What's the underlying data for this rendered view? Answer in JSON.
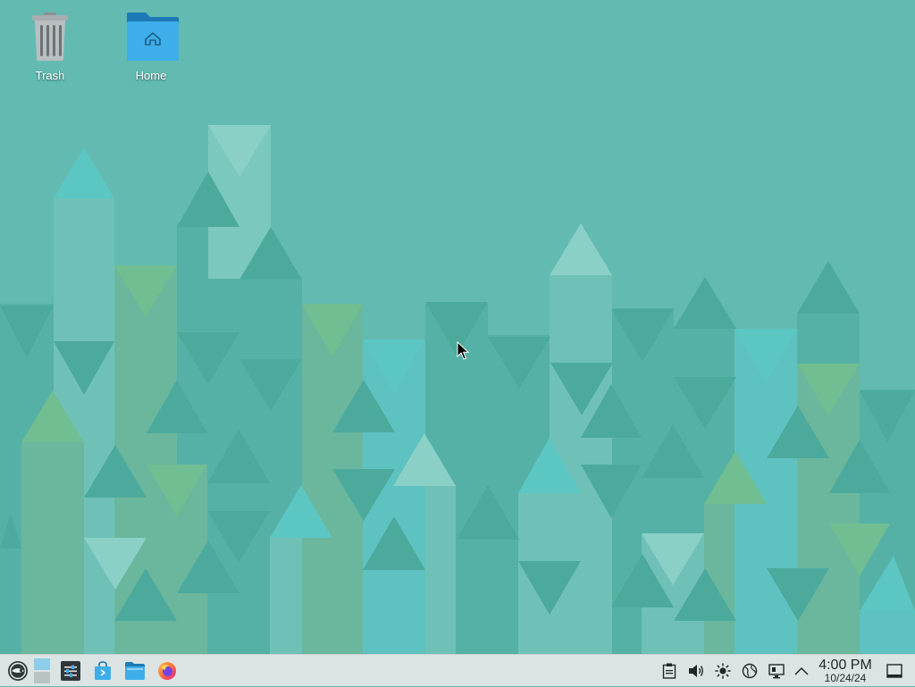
{
  "desktop": {
    "icons": [
      {
        "label": "Trash",
        "icon": "trash-icon"
      },
      {
        "label": "Home",
        "icon": "home-folder-icon"
      }
    ],
    "wallpaper_colors": {
      "base": "#63bab0",
      "dark": "#4fab9e",
      "light": "#8dd0c8",
      "cyan": "#5cc4c4",
      "green": "#72bb97"
    }
  },
  "taskbar": {
    "launchers": [
      {
        "name": "application-launcher",
        "icon": "opensuse-gecko-icon"
      },
      {
        "name": "virtual-desktop-pager",
        "icon": "pager-icon"
      },
      {
        "name": "system-settings",
        "icon": "settings-sliders-icon"
      },
      {
        "name": "discover",
        "icon": "shopping-bag-icon"
      },
      {
        "name": "dolphin-file-manager",
        "icon": "folder-icon"
      },
      {
        "name": "firefox",
        "icon": "firefox-icon"
      }
    ],
    "tray": [
      {
        "name": "clipboard",
        "icon": "clipboard-icon"
      },
      {
        "name": "volume",
        "icon": "speaker-icon"
      },
      {
        "name": "brightness",
        "icon": "brightness-icon"
      },
      {
        "name": "network",
        "icon": "globe-icon"
      },
      {
        "name": "display",
        "icon": "monitor-icon"
      },
      {
        "name": "show-hidden",
        "icon": "chevron-up-icon"
      }
    ],
    "clock": {
      "time": "4:00 PM",
      "date": "10/24/24"
    },
    "accent": "#3daee9"
  }
}
